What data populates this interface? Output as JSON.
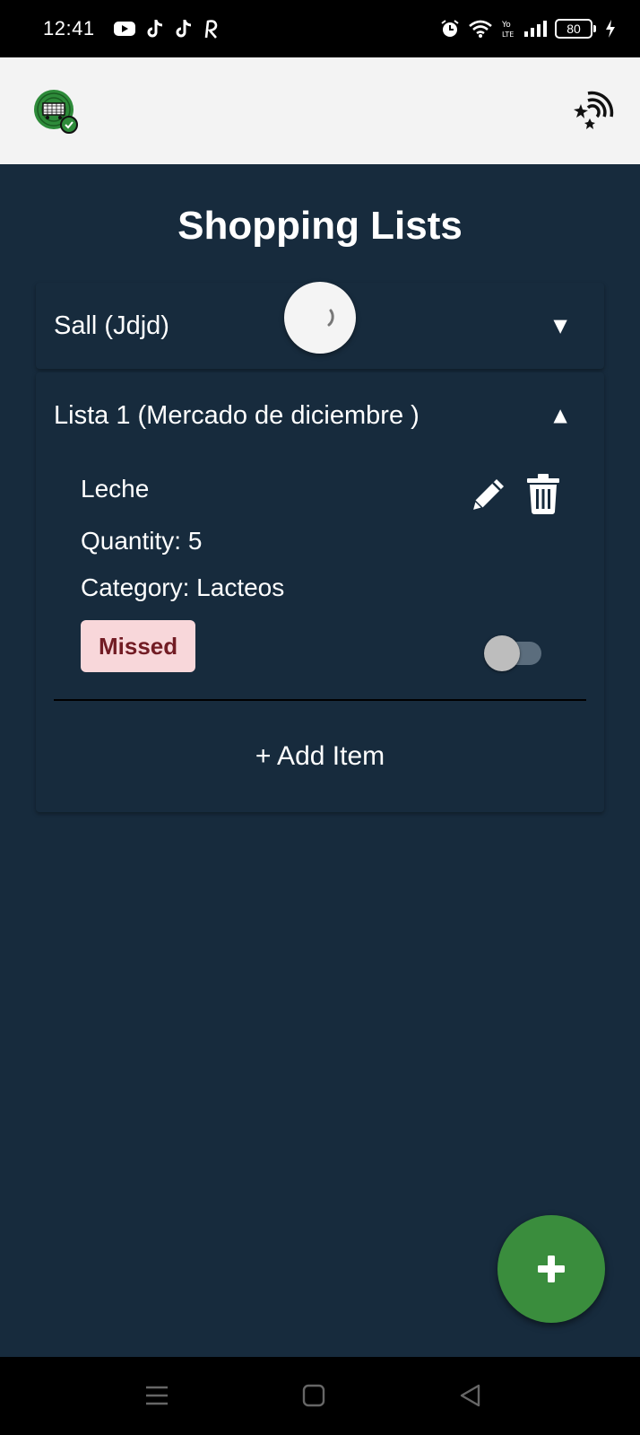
{
  "status_bar": {
    "time": "12:41",
    "left_icons": [
      "youtube-icon",
      "tiktok-icon",
      "tiktok-icon",
      "r-app-icon"
    ],
    "right_icons": [
      "alarm-icon",
      "wifi-icon",
      "volte-icon",
      "signal-icon"
    ],
    "battery_level": "80"
  },
  "app_bar": {
    "logo_icon": "shopping-basket-logo-icon",
    "theme_icon": "night-mode-icon"
  },
  "page": {
    "title": "Shopping Lists"
  },
  "lists": [
    {
      "title": "Sall (Jdjd)",
      "expanded": false,
      "chevron": "▼"
    },
    {
      "title": "Lista 1 (Mercado de diciembre )",
      "expanded": true,
      "chevron": "▲",
      "items": [
        {
          "name": "Leche",
          "quantity": "Quantity: 5",
          "category": "Category: Lacteos",
          "status": "Missed",
          "purchased": false
        }
      ],
      "add_item_label": "+ Add Item"
    }
  ],
  "colors": {
    "background": "#172b3d",
    "app_bar": "#f3f3f3",
    "fab": "#3a8d3d",
    "badge_bg": "#f8d7da",
    "badge_text": "#721c24"
  },
  "fab": {
    "icon": "plus-icon"
  }
}
